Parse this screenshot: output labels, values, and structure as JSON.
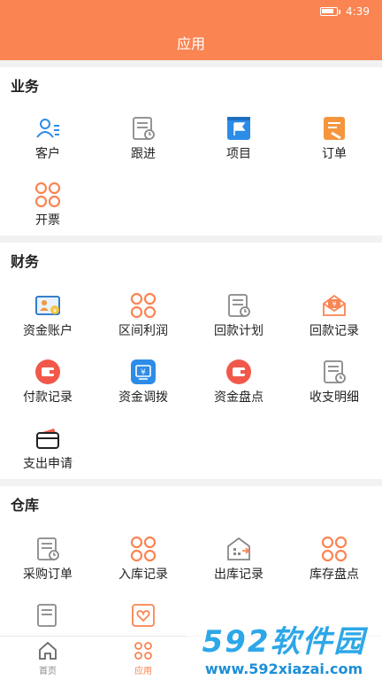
{
  "status": {
    "time": "4:39"
  },
  "header": {
    "title": "应用"
  },
  "sections": {
    "business": {
      "title": "业务",
      "items": [
        "客户",
        "跟进",
        "项目",
        "订单",
        "开票"
      ]
    },
    "finance": {
      "title": "财务",
      "items": [
        "资金账户",
        "区间利润",
        "回款计划",
        "回款记录",
        "付款记录",
        "资金调拨",
        "资金盘点",
        "收支明细",
        "支出申请"
      ]
    },
    "warehouse": {
      "title": "仓库",
      "items": [
        "采购订单",
        "入库记录",
        "出库记录",
        "库存盘点"
      ]
    }
  },
  "tabbar": {
    "tabs": [
      "首页",
      "应用"
    ]
  },
  "watermark": {
    "logo": "592软件园",
    "url": "www.592xiazai.com"
  },
  "colors": {
    "accent": "#fa8452",
    "blue": "#2d8ce8",
    "red": "#f2584a",
    "gray": "#888888"
  }
}
